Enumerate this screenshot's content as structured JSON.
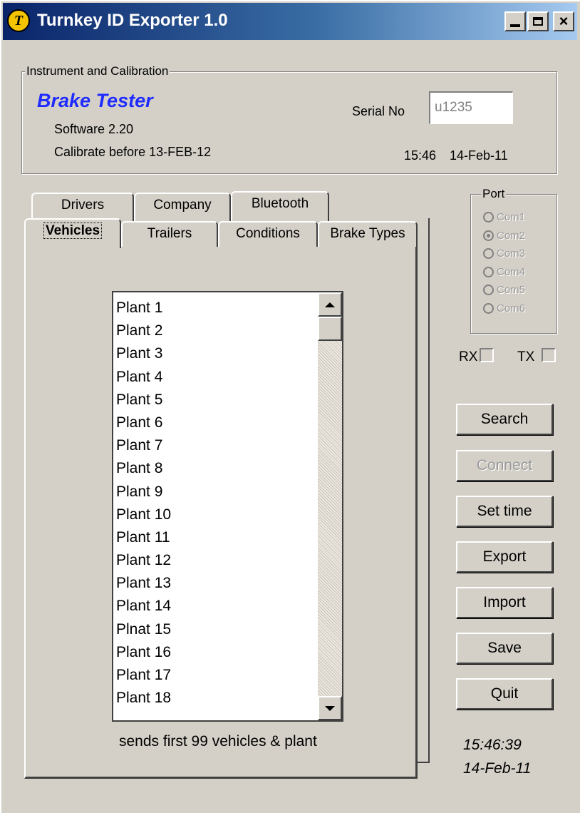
{
  "window": {
    "title": "Turnkey ID Exporter 1.0",
    "app_icon_letter": "T",
    "controls": {
      "minimize": "minimize",
      "maximize": "maximize",
      "close": "×"
    }
  },
  "instrument": {
    "group_title": "Instrument and Calibration",
    "name": "Brake Tester",
    "software": "Software 2.20",
    "calibrate": "Calibrate before 13-FEB-12",
    "serial_label": "Serial No",
    "serial_value": "u1235",
    "time": "15:46",
    "date": "14-Feb-11"
  },
  "tabs": {
    "back_row": [
      "Drivers",
      "Company",
      "Bluetooth"
    ],
    "front_row": [
      "Vehicles",
      "Trailers",
      "Conditions",
      "Brake Types"
    ],
    "active": "Vehicles"
  },
  "vehicles": {
    "items": [
      "Plant 1",
      "Plant 2",
      "Plant 3",
      "Plant 4",
      "Plant 5",
      "Plant 6",
      "Plant 7",
      "Plant 8",
      "Plant 9",
      "Plant 10",
      "Plant 11",
      "Plant 12",
      "Plant 13",
      "Plant 14",
      "Plnat 15",
      "Plant 16",
      "Plant 17",
      "Plant 18"
    ],
    "note": "sends first 99 vehicles & plant"
  },
  "port": {
    "title": "Port",
    "options": [
      "Com1",
      "Com2",
      "Com3",
      "Com4",
      "Com5",
      "Com6"
    ],
    "selected": "Com2",
    "rx_label": "RX",
    "tx_label": "TX"
  },
  "buttons": {
    "search": "Search",
    "connect": "Connect",
    "set_time": "Set time",
    "export": "Export",
    "import": "Import",
    "save": "Save",
    "quit": "Quit"
  },
  "clock": {
    "time": "15:46:39",
    "date": "14-Feb-11"
  },
  "colors": {
    "face": "#d4d0c8",
    "title_start": "#0a246a",
    "instrument_name": "#1f2bff",
    "disabled_text": "#9a9a9a"
  }
}
